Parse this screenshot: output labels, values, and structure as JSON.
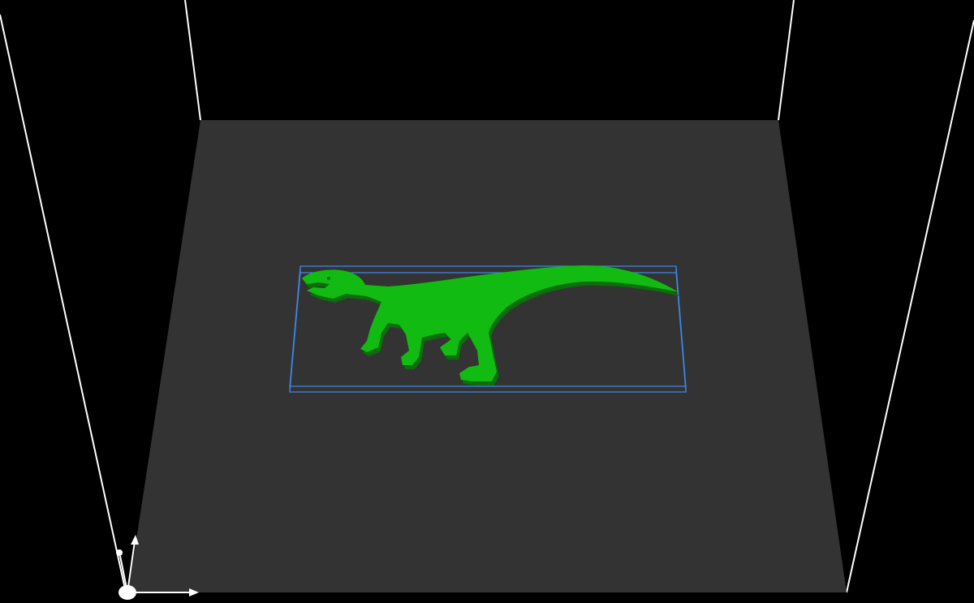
{
  "viewport": {
    "background_color": "#000000",
    "plate_color": "#333333",
    "frame_line_color": "#ffffff",
    "model_color": "#11bb11",
    "model_shadow_color": "#0a6e0a",
    "bounding_box_color": "#3f86e6"
  },
  "model": {
    "icon": "dinosaur-silhouette-icon"
  },
  "axes": {
    "icon": "axis-gizmo-icon"
  }
}
